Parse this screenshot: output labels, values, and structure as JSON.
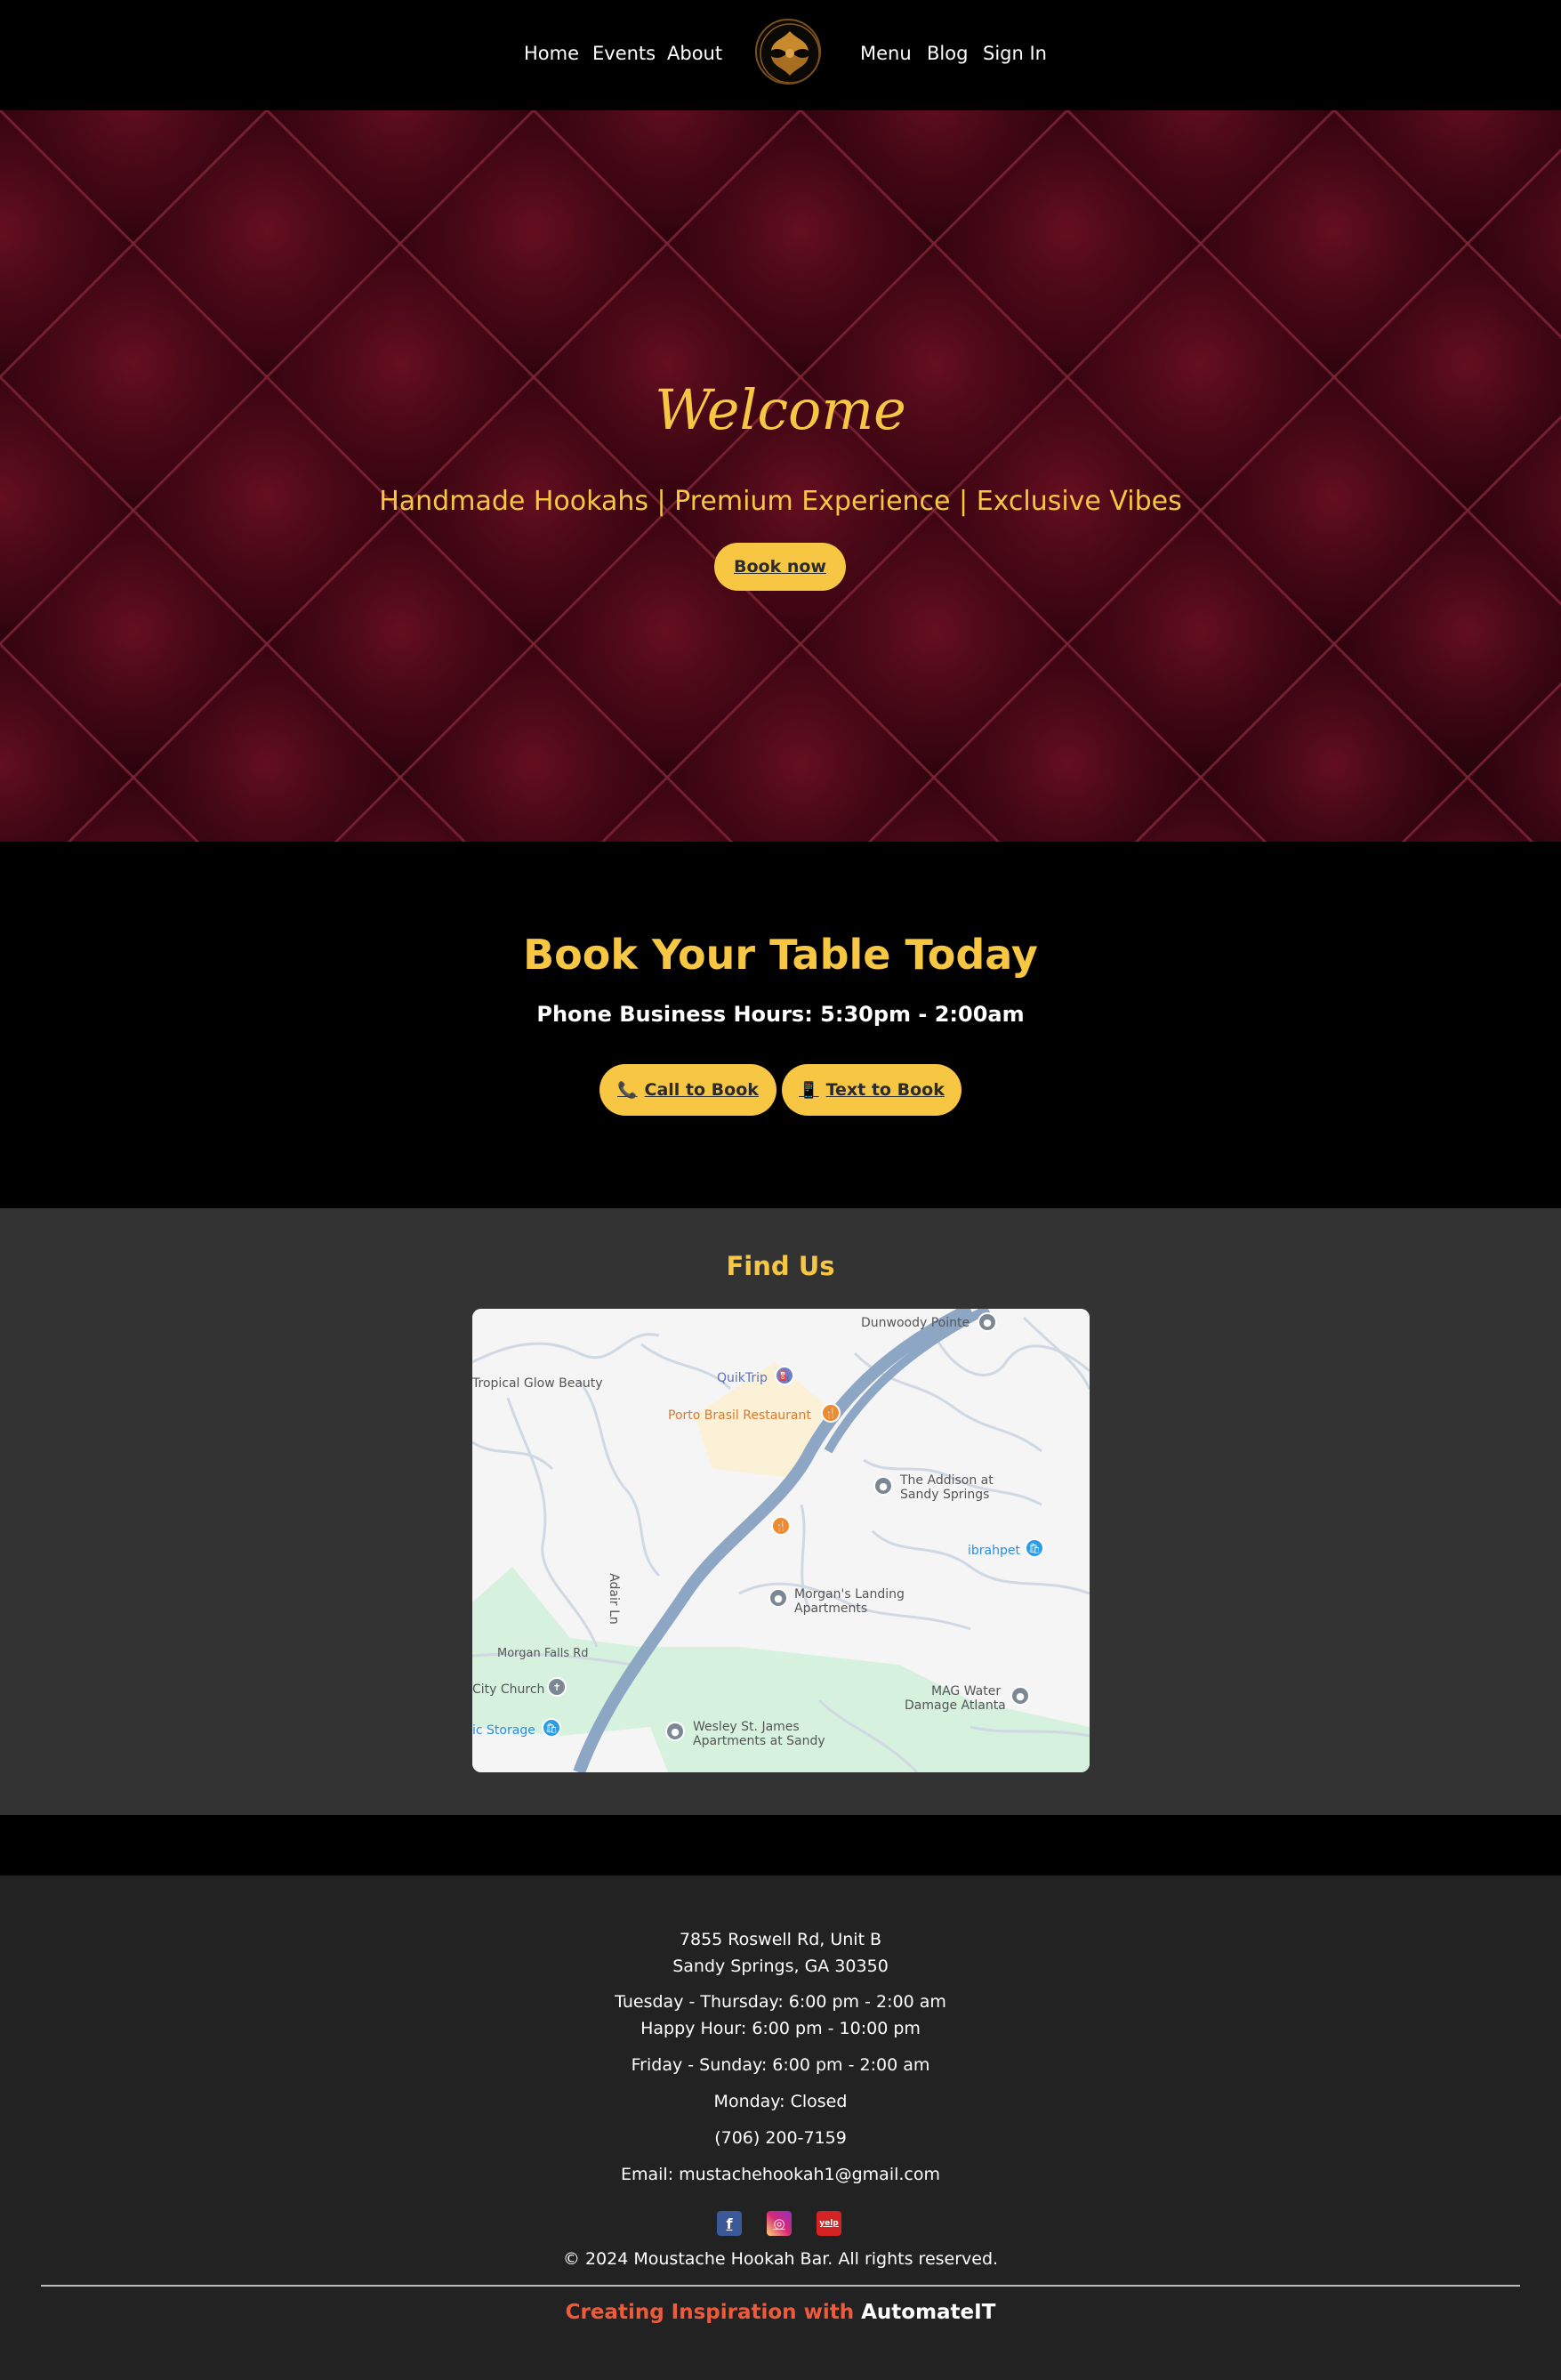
{
  "nav": {
    "left_items": [
      {
        "label": "Home"
      },
      {
        "label": "Events"
      },
      {
        "label": "About"
      }
    ],
    "right_items": [
      {
        "label": "Menu"
      },
      {
        "label": "Blog"
      },
      {
        "label": "Sign In"
      }
    ]
  },
  "hero": {
    "title": "Welcome",
    "tagline": "Handmade Hookahs | Premium Experience | Exclusive Vibes",
    "cta_label": "Book now"
  },
  "booking": {
    "title": "Book Your Table Today",
    "hours": "Phone Business Hours: 5:30pm - 2:00am",
    "call_label": "Call to Book",
    "text_label": "Text to Book"
  },
  "find_us": {
    "title": "Find Us",
    "map_labels": {
      "dunwoody": "Dunwoody Pointe",
      "tropical": "Tropical Glow Beauty",
      "quiktrip": "QuikTrip",
      "porto": "Porto Brasil Restaurant",
      "addison1": "The Addison at",
      "addison2": "Sandy Springs",
      "ibrahpet": "ibrahpet",
      "morgans1": "Morgan's Landing",
      "morgans2": "Apartments",
      "adair": "Adair Ln",
      "morganfalls": "Morgan Falls Rd",
      "church": "City Church",
      "storage": "ic Storage",
      "mag1": "MAG Water",
      "mag2": "Damage Atlanta",
      "wesley1": "Wesley St. James",
      "wesley2": "Apartments at Sandy"
    }
  },
  "footer": {
    "address_line1": "7855 Roswell Rd, Unit B",
    "address_line2": "Sandy Springs, GA 30350",
    "hours_weekday": "Tuesday - Thursday: 6:00 pm - 2:00 am",
    "happy_hour": "Happy Hour: 6:00 pm - 10:00 pm",
    "hours_weekend": "Friday - Sunday: 6:00 pm - 2:00 am",
    "monday": "Monday: Closed",
    "phone": "(706) 200-7159",
    "email": "Email: mustachehookah1@gmail.com",
    "copyright": "© 2024 Moustache Hookah Bar. All rights reserved.",
    "credit_prefix": "Creating Inspiration with",
    "credit_brand": "AutomateIT",
    "social": [
      {
        "name": "facebook-icon",
        "glyph": "f",
        "color": "#3b5998"
      },
      {
        "name": "instagram-icon",
        "glyph": "◎",
        "color": "#d62976"
      },
      {
        "name": "yelp-icon",
        "glyph": "yelp",
        "color": "#d32323"
      }
    ]
  },
  "colors": {
    "accent": "#f7c744",
    "hero_bg": "#4a0716",
    "section_dark": "#000000",
    "section_grey": "#333333",
    "footer_bg": "#222222",
    "credit_red": "#ef5b3a"
  }
}
